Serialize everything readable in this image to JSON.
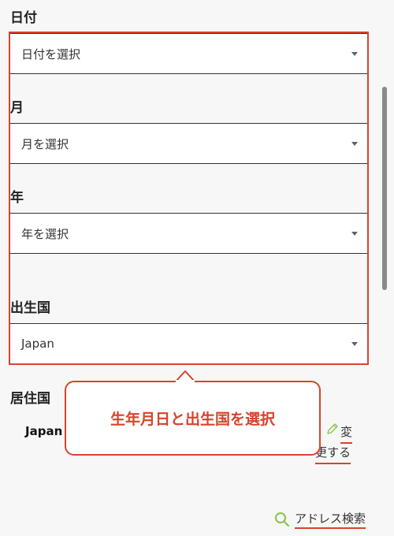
{
  "form": {
    "day": {
      "label": "日付",
      "placeholder": "日付を選択"
    },
    "month": {
      "label": "月",
      "placeholder": "月を選択"
    },
    "year": {
      "label": "年",
      "placeholder": "年を選択"
    },
    "birth_country": {
      "label": "出生国",
      "value": "Japan"
    },
    "residence": {
      "label": "居住国",
      "value": "Japan",
      "change_line1": "変",
      "change_line2": "更する"
    }
  },
  "callout": {
    "text": "生年月日と出生国を選択"
  },
  "address_search": {
    "label": "アドレス検索"
  },
  "colors": {
    "accent": "#d9432c",
    "caret": "#5a6170",
    "search_icon": "#8bc34a"
  },
  "icons": [
    "chevron-down-icon",
    "pencil-icon",
    "search-icon"
  ]
}
